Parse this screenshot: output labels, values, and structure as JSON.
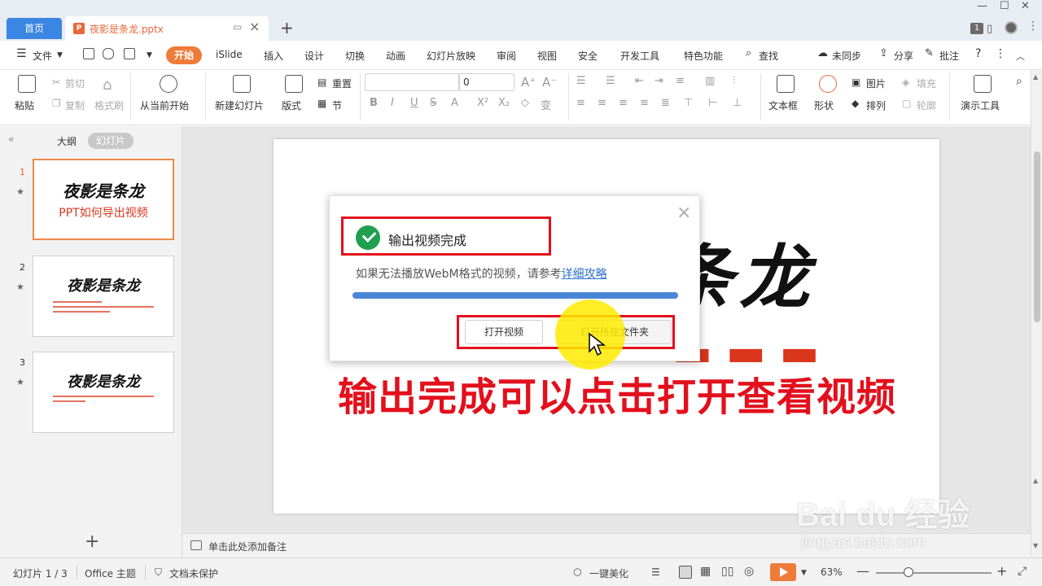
{
  "titlebar": {
    "home_tab": "首页",
    "doc_tab": "夜影是条龙.pptx",
    "doc_icon_letter": "P",
    "window_badge": "1"
  },
  "menu": {
    "file": "文件",
    "items": [
      "开始",
      "iSlide",
      "插入",
      "设计",
      "切换",
      "动画",
      "幻灯片放映",
      "审阅",
      "视图",
      "安全",
      "开发工具",
      "特色功能"
    ],
    "search": "查找",
    "sync": "未同步",
    "share": "分享",
    "comment": "批注"
  },
  "ribbon": {
    "paste": "粘贴",
    "cut": "剪切",
    "copy": "复制",
    "format_painter": "格式刷",
    "from_current": "从当前开始",
    "new_slide": "新建幻灯片",
    "layout": "版式",
    "reset": "重置",
    "section": "节",
    "font_size": "0",
    "textbox": "文本框",
    "shapes": "形状",
    "picture": "图片",
    "fill": "填充",
    "arrange": "排列",
    "outline": "轮廓",
    "presentation_tools": "演示工具"
  },
  "left_panel": {
    "outline_tab": "大纲",
    "slides_tab": "幻灯片",
    "slides": [
      {
        "num": "1",
        "title": "夜影是条龙",
        "subtitle": "PPT如何导出视频"
      },
      {
        "num": "2",
        "title": "夜影是条龙"
      },
      {
        "num": "3",
        "title": "夜影是条龙"
      }
    ]
  },
  "slide": {
    "title_fragment": "条龙"
  },
  "notes": {
    "placeholder": "单击此处添加备注"
  },
  "dialog": {
    "title": "输出视频完成",
    "message": "如果无法播放WebM格式的视频，请参考",
    "link": "详细攻略",
    "progress": 1.0,
    "btn_open_video": "打开视频",
    "btn_open_folder": "打开所在文件夹",
    "highlight_color": "#e3101c"
  },
  "caption": "输出完成可以点击打开查看视频",
  "status": {
    "slide_info": "幻灯片 1 / 3",
    "theme": "Office 主题",
    "protect": "文档未保护",
    "beautify": "一键美化",
    "zoom": "63%"
  },
  "watermark": {
    "brand": "Bai du 经验",
    "url": "jingyan.baidu.com"
  },
  "colors": {
    "accent_orange": "#ef7b3a",
    "home_blue": "#3b86e2",
    "caption_red": "#e3101c",
    "success_green": "#1fa04f"
  }
}
